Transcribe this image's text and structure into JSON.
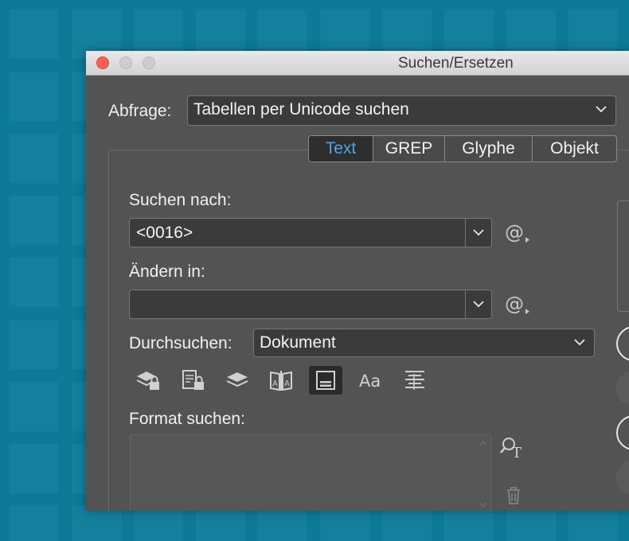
{
  "window": {
    "title": "Suchen/Ersetzen"
  },
  "query": {
    "label": "Abfrage:",
    "value": "Tabellen per Unicode suchen"
  },
  "tabs": [
    {
      "label": "Text",
      "active": true
    },
    {
      "label": "GREP",
      "active": false
    },
    {
      "label": "Glyphe",
      "active": false
    },
    {
      "label": "Objekt",
      "active": false
    }
  ],
  "find": {
    "label": "Suchen nach:",
    "value": "<0016>"
  },
  "change": {
    "label": "Ändern in:",
    "value": ""
  },
  "search": {
    "label": "Durchsuchen:",
    "value": "Dokument"
  },
  "format": {
    "label": "Format suchen:"
  },
  "options_icons": [
    "locked-layers-icon",
    "locked-stories-icon",
    "hidden-layers-icon",
    "master-pages-icon",
    "footnotes-icon",
    "case-sensitive-icon",
    "whole-word-icon"
  ],
  "colors": {
    "accent": "#4aa7ea",
    "desktop": "#0d7a98",
    "dialog": "#535353"
  }
}
